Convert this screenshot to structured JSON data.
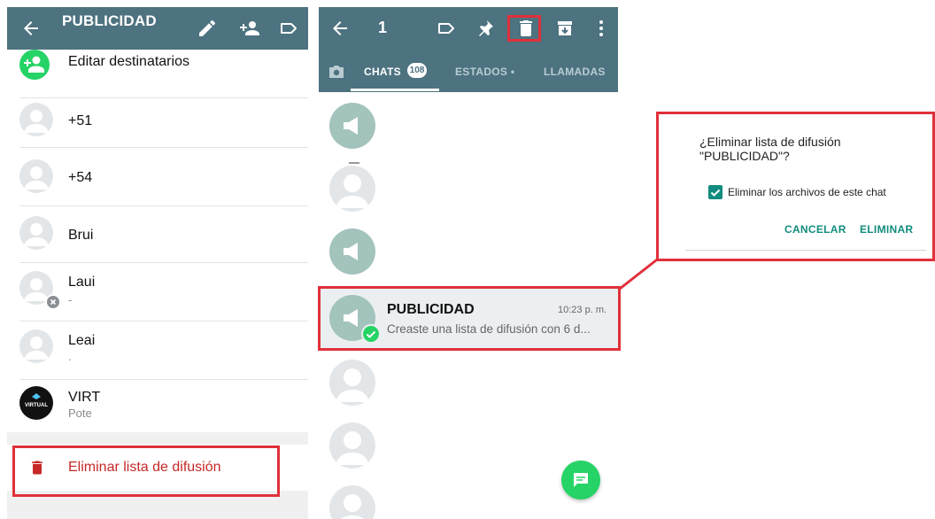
{
  "left": {
    "toolbar": {
      "title": "PUBLICIDAD"
    },
    "edit_recipients": "Editar destinatarios",
    "contacts": [
      {
        "name": "+51",
        "sub": ""
      },
      {
        "name": "+54",
        "sub": ""
      },
      {
        "name": "Brui",
        "sub": ""
      },
      {
        "name": "Laui",
        "sub": "-"
      },
      {
        "name": "Leai",
        "sub": "."
      },
      {
        "name": "VIRT",
        "sub": "Pote",
        "logo_text": "VIRTUAL"
      }
    ],
    "delete_list": "Eliminar lista de difusión"
  },
  "middle": {
    "selected_count": "1",
    "tabs": {
      "chats": "CHATS",
      "chats_badge": "108",
      "estados": "ESTADOS •",
      "llamadas": "LLAMADAS"
    },
    "selected_chat": {
      "title": "PUBLICIDAD",
      "time": "10:23 p. m.",
      "preview": "Creaste una lista de difusión con 6 d..."
    }
  },
  "dialog": {
    "question": "¿Eliminar lista de difusión \"PUBLICIDAD\"?",
    "checkbox_label": "Eliminar los archivos de este chat",
    "checkbox_checked": true,
    "cancel": "CANCELAR",
    "confirm": "ELIMINAR"
  },
  "colors": {
    "toolbar": "#4d7280",
    "accent_green": "#25d366",
    "teal": "#128c7e",
    "highlight_red": "#e0303a",
    "delete_red": "#c62828"
  }
}
